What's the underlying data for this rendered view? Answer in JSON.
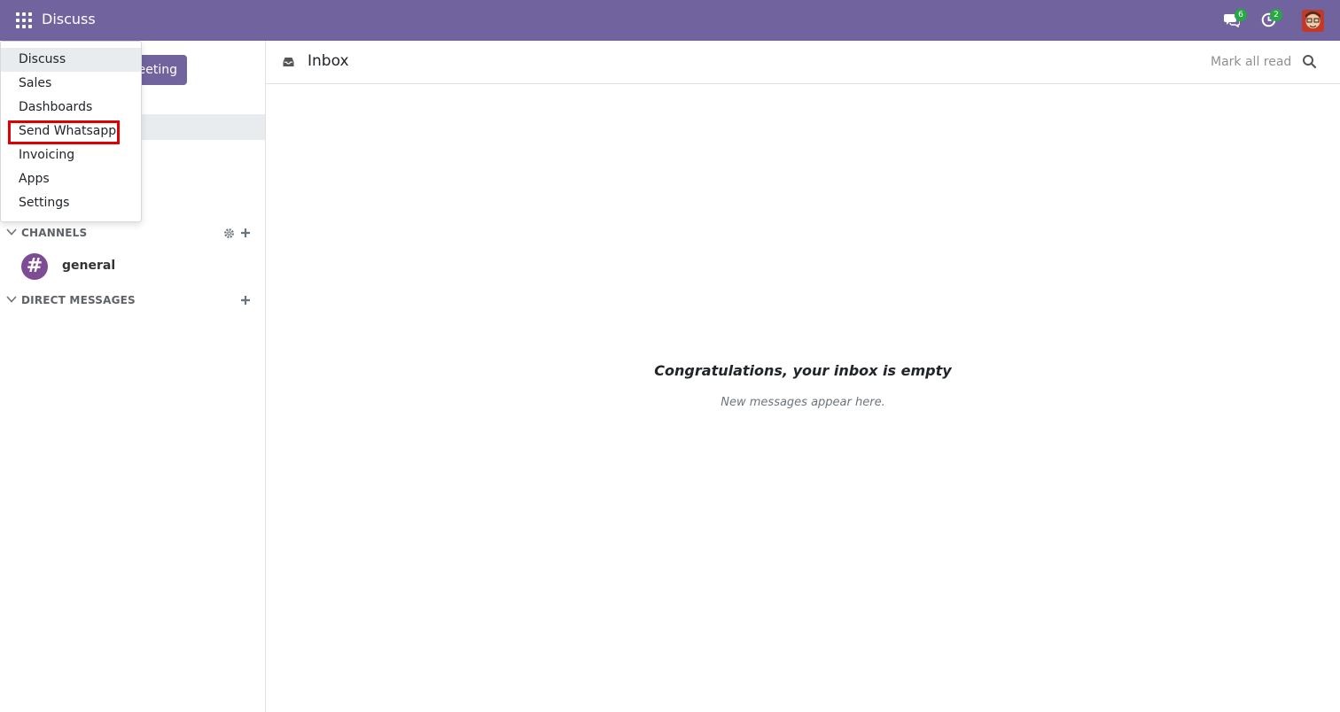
{
  "navbar": {
    "app_title": "Discuss",
    "messages_badge": "6",
    "activities_badge": "2",
    "color": "#71639e"
  },
  "sidebar": {
    "meeting_button": "Start a meeting",
    "meeting_button_visible": "eeting",
    "channels_header": "CHANNELS",
    "channels": [
      {
        "name": "general",
        "icon": "#"
      }
    ],
    "direct_messages_header": "DIRECT MESSAGES"
  },
  "apps_menu": {
    "items": [
      {
        "label": "Discuss"
      },
      {
        "label": "Sales"
      },
      {
        "label": "Dashboards"
      },
      {
        "label": "Send Whatsapp"
      },
      {
        "label": "Invoicing"
      },
      {
        "label": "Apps"
      },
      {
        "label": "Settings"
      }
    ],
    "highlighted_item": "Send Whatsapp"
  },
  "main": {
    "title": "Inbox",
    "mark_all_read": "Mark all read",
    "empty_title": "Congratulations, your inbox is empty",
    "empty_subtitle": "New messages appear here."
  },
  "colors": {
    "brand": "#71639e",
    "badge": "#28a745",
    "highlight": "#e00000",
    "channel_avatar": "#7e4c94"
  },
  "icons": [
    "apps-grid-icon",
    "chat-icon",
    "clock-icon",
    "inbox-icon",
    "search-icon",
    "chevron-down-icon",
    "gear-icon",
    "plus-icon",
    "hash-icon"
  ]
}
